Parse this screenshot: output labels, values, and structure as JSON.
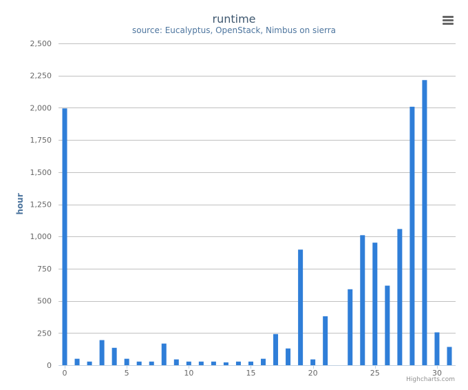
{
  "chart_data": {
    "type": "bar",
    "title": "runtime",
    "subtitle": "source: Eucalyptus, OpenStack, Nimbus on sierra",
    "ylabel": "hour",
    "xlabel": "",
    "ylim": [
      0,
      2500
    ],
    "xlim": [
      -0.5,
      31.5
    ],
    "yticks": [
      0,
      250,
      500,
      750,
      1000,
      1250,
      1500,
      1750,
      2000,
      2250,
      2500
    ],
    "ytick_labels": [
      "0",
      "250",
      "500",
      "750",
      "1,000",
      "1,250",
      "1,500",
      "1,750",
      "2,000",
      "2,250",
      "2,500"
    ],
    "xticks": [
      0,
      5,
      10,
      15,
      20,
      25,
      30
    ],
    "xtick_labels": [
      "0",
      "5",
      "10",
      "15",
      "20",
      "25",
      "30"
    ],
    "grid": true,
    "legend": "none",
    "x": [
      0,
      1,
      2,
      3,
      4,
      5,
      6,
      7,
      8,
      9,
      10,
      11,
      12,
      13,
      14,
      15,
      16,
      17,
      18,
      19,
      20,
      21,
      22,
      23,
      24,
      25,
      26,
      27,
      28,
      29,
      30,
      31
    ],
    "values": [
      1995,
      50,
      28,
      195,
      135,
      50,
      28,
      28,
      168,
      45,
      28,
      28,
      28,
      22,
      28,
      28,
      50,
      242,
      130,
      898,
      45,
      380,
      0,
      590,
      1010,
      952,
      618,
      1058,
      2008,
      2215,
      255,
      142
    ],
    "colors": {
      "bar": "#2f7ed8",
      "grid": "#c0c0c0",
      "axis": "#c0d0e0",
      "title": "#3e576f",
      "subtitle": "#4d759e",
      "tick": "#666666"
    }
  },
  "credits": "Highcharts.com",
  "menu": {
    "icon": "menu-icon"
  }
}
